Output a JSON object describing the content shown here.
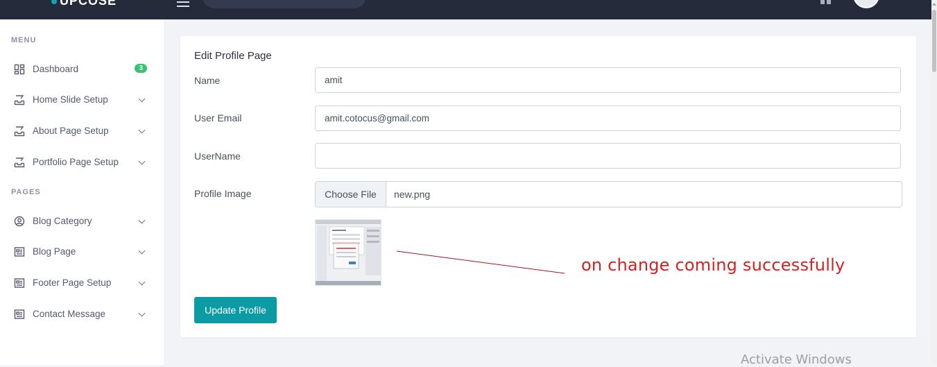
{
  "topbar": {
    "brand": "UPCOSE"
  },
  "sidebar": {
    "menu_title": "MENU",
    "pages_title": "PAGES",
    "items": [
      {
        "label": "Dashboard",
        "icon": "dashboard-grid-icon",
        "badge": "3"
      },
      {
        "label": "Home Slide Setup",
        "icon": "inbox-tray-icon"
      },
      {
        "label": "About Page Setup",
        "icon": "inbox-tray-icon"
      },
      {
        "label": "Portfolio Page Setup",
        "icon": "inbox-tray-icon"
      },
      {
        "label": "Blog Category",
        "icon": "user-circle-icon"
      },
      {
        "label": "Blog Page",
        "icon": "newspaper-icon"
      },
      {
        "label": "Footer Page Setup",
        "icon": "newspaper-icon"
      },
      {
        "label": "Contact Message",
        "icon": "newspaper-icon"
      }
    ],
    "badge_color": "#38c172"
  },
  "form": {
    "title": "Edit Profile Page",
    "name_label": "Name",
    "name_value": "amit",
    "email_label": "User Email",
    "email_value": "amit.cotocus@gmail.com",
    "username_label": "UserName",
    "username_value": "",
    "image_label": "Profile Image",
    "choose_file_label": "Choose File",
    "file_name": "new.png",
    "submit_label": "Update Profile",
    "accent_color": "#0b9ba5"
  },
  "annotation": {
    "text": "on change coming successfully",
    "color": "#d32222"
  },
  "watermark": {
    "text": "Activate Windows"
  }
}
